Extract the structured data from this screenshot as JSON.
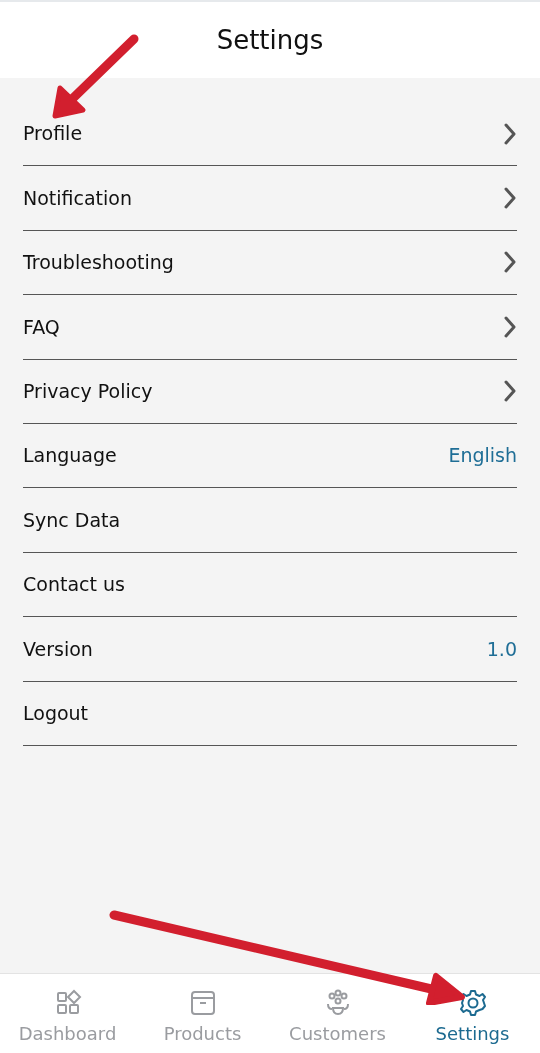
{
  "header": {
    "title": "Settings"
  },
  "items": [
    {
      "label": "Profile",
      "kind": "link"
    },
    {
      "label": "Notification",
      "kind": "link"
    },
    {
      "label": "Troubleshooting",
      "kind": "link"
    },
    {
      "label": "FAQ",
      "kind": "link"
    },
    {
      "label": "Privacy Policy",
      "kind": "link"
    },
    {
      "label": "Language",
      "kind": "value",
      "value": "English"
    },
    {
      "label": "Sync Data",
      "kind": "plain"
    },
    {
      "label": "Contact us",
      "kind": "plain"
    },
    {
      "label": "Version",
      "kind": "value",
      "value": "1.0"
    },
    {
      "label": "Logout",
      "kind": "plain"
    }
  ],
  "bottom_nav": [
    {
      "label": "Dashboard",
      "selected": false
    },
    {
      "label": "Products",
      "selected": false
    },
    {
      "label": "Customers",
      "selected": false
    },
    {
      "label": "Settings",
      "selected": true
    }
  ]
}
